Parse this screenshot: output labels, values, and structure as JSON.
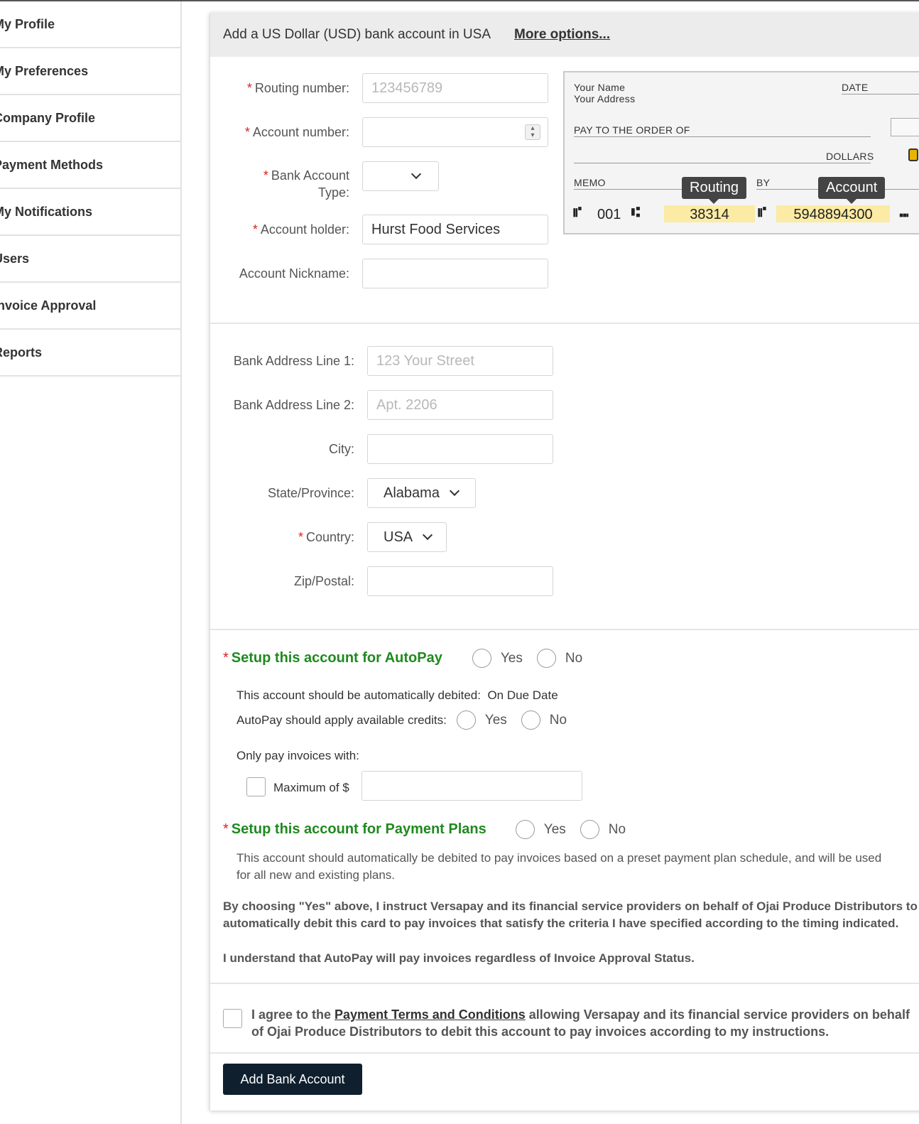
{
  "sidebar": {
    "items": [
      {
        "label": "My Profile"
      },
      {
        "label": "My Preferences"
      },
      {
        "label": "Company Profile"
      },
      {
        "label": "Payment Methods"
      },
      {
        "label": "My Notifications"
      },
      {
        "label": "Users"
      },
      {
        "label": "Invoice Approval"
      },
      {
        "label": "Reports"
      }
    ]
  },
  "banner": {
    "title": "Add a US Dollar (USD) bank account in USA",
    "more_options": "More options..."
  },
  "account_form": {
    "routing_label": "Routing number:",
    "routing_placeholder": "123456789",
    "account_number_label": "Account number:",
    "account_number_value": "",
    "account_type_label_1": "Bank Account",
    "account_type_label_2": "Type:",
    "account_type_value": "",
    "holder_label": "Account holder:",
    "holder_value": "Hurst Food Services",
    "nickname_label": "Account Nickname:",
    "nickname_value": ""
  },
  "check_image": {
    "your_name": "Your Name",
    "your_address": "Your Address",
    "date": "DATE",
    "pay_to": "PAY TO THE ORDER OF",
    "dollars": "DOLLARS",
    "memo": "MEMO",
    "by": "BY",
    "routing_tip": "Routing",
    "account_tip": "Account",
    "check_no": "001",
    "routing_value": "38314",
    "account_value": "5948894300"
  },
  "address_form": {
    "line1_label": "Bank Address Line 1:",
    "line1_placeholder": "123 Your Street",
    "line2_label": "Bank Address Line 2:",
    "line2_placeholder": "Apt. 2206",
    "city_label": "City:",
    "city_value": "",
    "state_label": "State/Province:",
    "state_value": "Alabama",
    "country_label": "Country:",
    "country_value": "USA",
    "zip_label": "Zip/Postal:",
    "zip_value": ""
  },
  "autopay": {
    "heading": "Setup this account for AutoPay",
    "yes": "Yes",
    "no": "No",
    "debit_text": "This account should be automatically debited:",
    "debit_value": "On Due Date",
    "credits_label": "AutoPay should apply available credits:",
    "only_pay": "Only pay invoices with:",
    "maximum_label": "Maximum of $",
    "maximum_value": ""
  },
  "payment_plans": {
    "heading": "Setup this account for Payment Plans",
    "yes": "Yes",
    "no": "No",
    "desc_line1": "This account should automatically be debited to pay invoices based on a preset payment plan schedule, and will be used",
    "desc_line2": "for all new and existing plans.",
    "consent_line1": "By choosing \"Yes\" above, I instruct Versapay and its financial service providers on behalf of Ojai Produce Distributors to",
    "consent_line2": "automatically debit this card to pay invoices that satisfy the criteria I have specified according to the timing indicated.",
    "understand": "I understand that AutoPay will pay invoices regardless of Invoice Approval Status."
  },
  "terms": {
    "prefix": "I agree to the ",
    "link": "Payment Terms and Conditions",
    "suffix": " allowing Versapay and its financial service providers on behalf",
    "line2": "of Ojai Produce Distributors to debit this account to pay invoices according to my instructions."
  },
  "submit_label": "Add Bank Account",
  "colors": {
    "accent_green": "#1f8a1f",
    "required_red": "#d22222",
    "button_navy": "#0f1f2e",
    "highlight_yellow": "#fbeba4"
  }
}
